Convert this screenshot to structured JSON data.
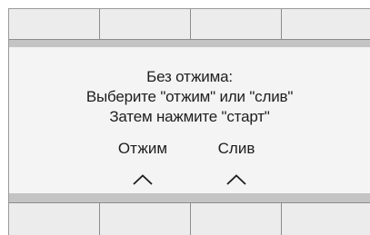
{
  "screen": {
    "message_lines": [
      "Без отжима:",
      "Выберите \"отжим\" или \"слив\"",
      "Затем нажмите \"старт\""
    ],
    "options": [
      {
        "label": "Отжим",
        "icon": "chevron-up-icon"
      },
      {
        "label": "Слив",
        "icon": "chevron-up-icon"
      }
    ]
  },
  "colors": {
    "panel_bg": "#f4f4f4",
    "band_gray": "#c4c4c4",
    "button_bg": "#ececec",
    "text": "#1e1e1e"
  }
}
